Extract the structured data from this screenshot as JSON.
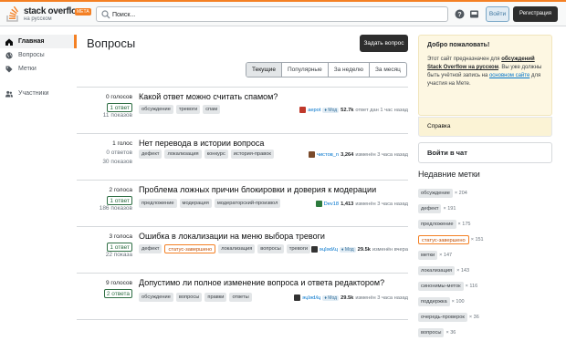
{
  "header": {
    "logo_text": "stack overflow",
    "logo_beta": "МЕТА",
    "logo_sub": "на русском",
    "search_placeholder": "Поиск...",
    "login_label": "Войти",
    "signup_label": "Регистрация"
  },
  "nav": {
    "items": [
      {
        "label": "Главная",
        "icon": "home-icon",
        "active": true
      },
      {
        "label": "Вопросы",
        "icon": "globe-icon",
        "active": false
      },
      {
        "label": "Метки",
        "icon": "tag-icon",
        "active": false
      },
      {
        "label": "Участники",
        "icon": "users-icon",
        "active": false
      }
    ]
  },
  "main": {
    "title": "Вопросы",
    "ask_label": "Задать вопрос",
    "filters": [
      {
        "label": "Текущие",
        "active": true
      },
      {
        "label": "Популярные",
        "active": false
      },
      {
        "label": "За неделю",
        "active": false
      },
      {
        "label": "За месяц",
        "active": false
      }
    ],
    "questions": [
      {
        "votes": "0 голосов",
        "answers": "1 ответ",
        "answers_boxed": true,
        "views": "11 показов",
        "title": "Какой ответ можно считать спамом?",
        "tags": [
          {
            "t": "обсуждение"
          },
          {
            "t": "тревоги"
          },
          {
            "t": "спам"
          }
        ],
        "user": "aepot",
        "user_color": "#c0392b",
        "mod": "♦ Мод",
        "rep": "52.7k",
        "when": "ответ дан 1 час назад"
      },
      {
        "votes": "1 голос",
        "answers": "0 ответов",
        "answers_boxed": false,
        "views": "30 показов",
        "title": "Нет перевода в истории вопроса",
        "tags": [
          {
            "t": "дефект"
          },
          {
            "t": "локализация"
          },
          {
            "t": "конкурс"
          },
          {
            "t": "история-правок"
          }
        ],
        "user": "чистов_n",
        "user_color": "#7a4a2a",
        "mod": "",
        "rep": "3,264",
        "when": "изменён 3 часа назад"
      },
      {
        "votes": "2 голоса",
        "answers": "1 ответ",
        "answers_boxed": true,
        "views": "186 показов",
        "title": "Проблема ложных причин блокировки и доверия к модерации",
        "tags": [
          {
            "t": "предложение"
          },
          {
            "t": "модерация"
          },
          {
            "t": "модераторский-произвол"
          }
        ],
        "user": "Dev18",
        "user_color": "#2c7a3d",
        "mod": "",
        "rep": "1,413",
        "when": "изменён 3 часа назад"
      },
      {
        "votes": "3 голоса",
        "answers": "1 ответ",
        "answers_boxed": true,
        "views": "22 показа",
        "title": "Ошибка в локализации на меню выбора тревоги",
        "tags": [
          {
            "t": "дефект"
          },
          {
            "t": "статус-завершено",
            "status": true
          },
          {
            "t": "локализация"
          },
          {
            "t": "вопросы"
          },
          {
            "t": "тревоги"
          }
        ],
        "user": "ǝɥʇǝdʎɥ",
        "user_color": "#333333",
        "mod": "♦ Мод",
        "rep": "29.5k",
        "when": "изменён вчера"
      },
      {
        "votes": "9 голосов",
        "answers": "2 ответа",
        "answers_boxed": true,
        "views": "",
        "title": "Допустимо ли полное изменение вопроса и ответа редактором?",
        "tags": [
          {
            "t": "обсуждение"
          },
          {
            "t": "вопросы"
          },
          {
            "t": "правки"
          },
          {
            "t": "ответы"
          }
        ],
        "user": "ǝɥʇǝdʎɥ",
        "user_color": "#333333",
        "mod": "♦ Мод",
        "rep": "29.5k",
        "when": "изменён 3 часа назад"
      }
    ]
  },
  "sidebar": {
    "welcome_title": "Добро пожаловать!",
    "welcome_p1": "Этот сайт предназначен для ",
    "welcome_b1": "обсуждений Stack Overflow на русском",
    "welcome_p2": ". Вы уже должны быть учётной запись на ",
    "welcome_link": "основном сайте",
    "welcome_p3": " для участия на Мете.",
    "help_label": "Справка",
    "chat_label": "Войти в чат",
    "recent_title": "Недавние метки",
    "recent_tags": [
      {
        "t": "обсуждение",
        "c": "× 204"
      },
      {
        "t": "дефект",
        "c": "× 191"
      },
      {
        "t": "предложение",
        "c": "× 175"
      },
      {
        "t": "статус-завершено",
        "c": "× 151",
        "status": true
      },
      {
        "t": "метки",
        "c": "× 147"
      },
      {
        "t": "локализация",
        "c": "× 143"
      },
      {
        "t": "синонимы-меток",
        "c": "× 116"
      },
      {
        "t": "поддержка",
        "c": "× 100"
      },
      {
        "t": "очередь-проверок",
        "c": "× 36"
      },
      {
        "t": "вопросы",
        "c": "× 36"
      }
    ]
  }
}
